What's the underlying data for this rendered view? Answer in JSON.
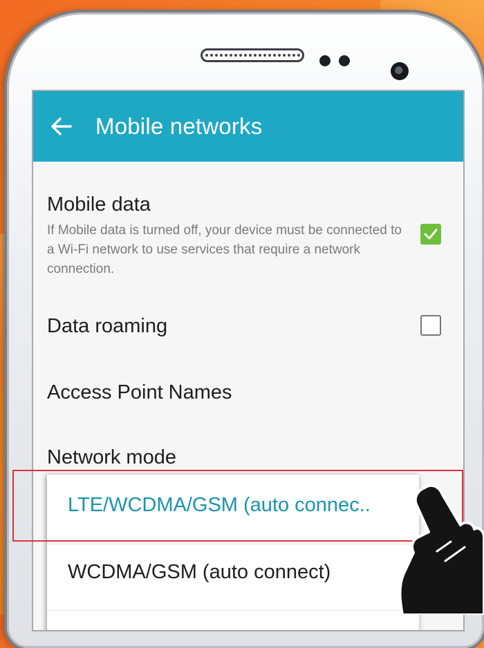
{
  "appbar": {
    "title": "Mobile networks",
    "back_icon": "arrow-left-icon",
    "color": "#1fa8c4"
  },
  "settings": {
    "mobile_data": {
      "label": "Mobile data",
      "description": "If Mobile data is turned off, your device must be connected to a Wi-Fi network to use services that require a network connection.",
      "checked": true
    },
    "data_roaming": {
      "label": "Data roaming",
      "checked": false
    },
    "access_point_names": {
      "label": "Access Point Names"
    },
    "network_mode": {
      "label": "Network mode"
    }
  },
  "network_mode_options": [
    {
      "label": "LTE/WCDMA/GSM (auto connec..",
      "selected": true,
      "color": "#1a94ad"
    },
    {
      "label": "WCDMA/GSM (auto connect)",
      "selected": false
    }
  ],
  "colors": {
    "checkbox_on": "#6dbf3c",
    "highlight_border": "#e0303a",
    "background": "#f26a23"
  },
  "decor": {
    "pointer": "pointing-hand-icon"
  }
}
